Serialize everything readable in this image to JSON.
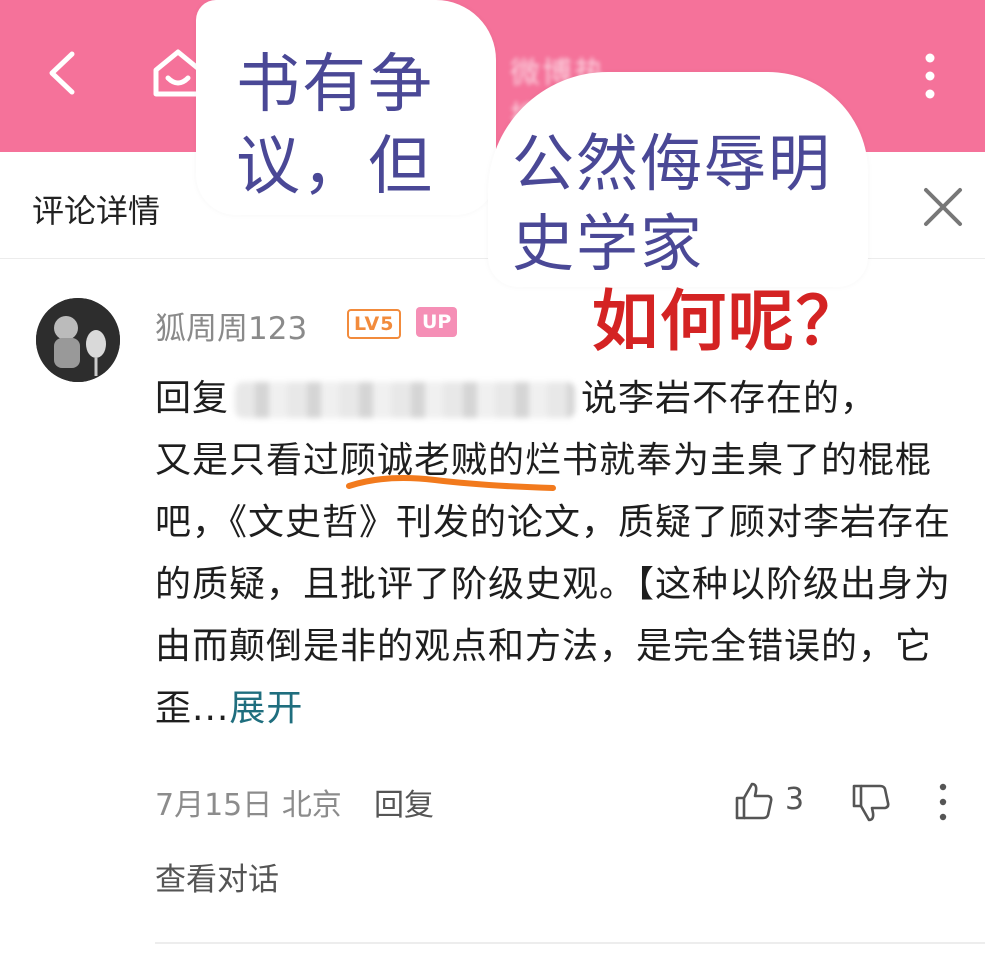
{
  "topbar": {
    "color": "#f5729a",
    "blurred_title": "微博热搜"
  },
  "header": {
    "title": "评论详情"
  },
  "comment": {
    "username": "狐周周123",
    "level_badge": "LV5",
    "up_badge": "UP",
    "reply_prefix": "回复",
    "line1_after": "说李岩不存在的，",
    "body": "又是只看过顾诚老贼的烂书就奉为圭臬了的棍棍吧，《文史哲》刊发的论文，质疑了顾对李岩存在的质疑，且批评了阶级史观。【这种以阶级出身为由而颠倒是非的观点和方法，是完全错误的，它歪...",
    "expand_label": "展开",
    "date": "7月15日",
    "location": "北京",
    "reply_label": "回复",
    "like_count": "3",
    "view_conversation": "查看对话"
  },
  "overlay": {
    "bubble1_text": "书有争议，但",
    "bubble2_text": "公然侮辱明史学家",
    "red_text": "如何呢？",
    "text_color": "#4a4896",
    "red_color": "#d42323"
  }
}
